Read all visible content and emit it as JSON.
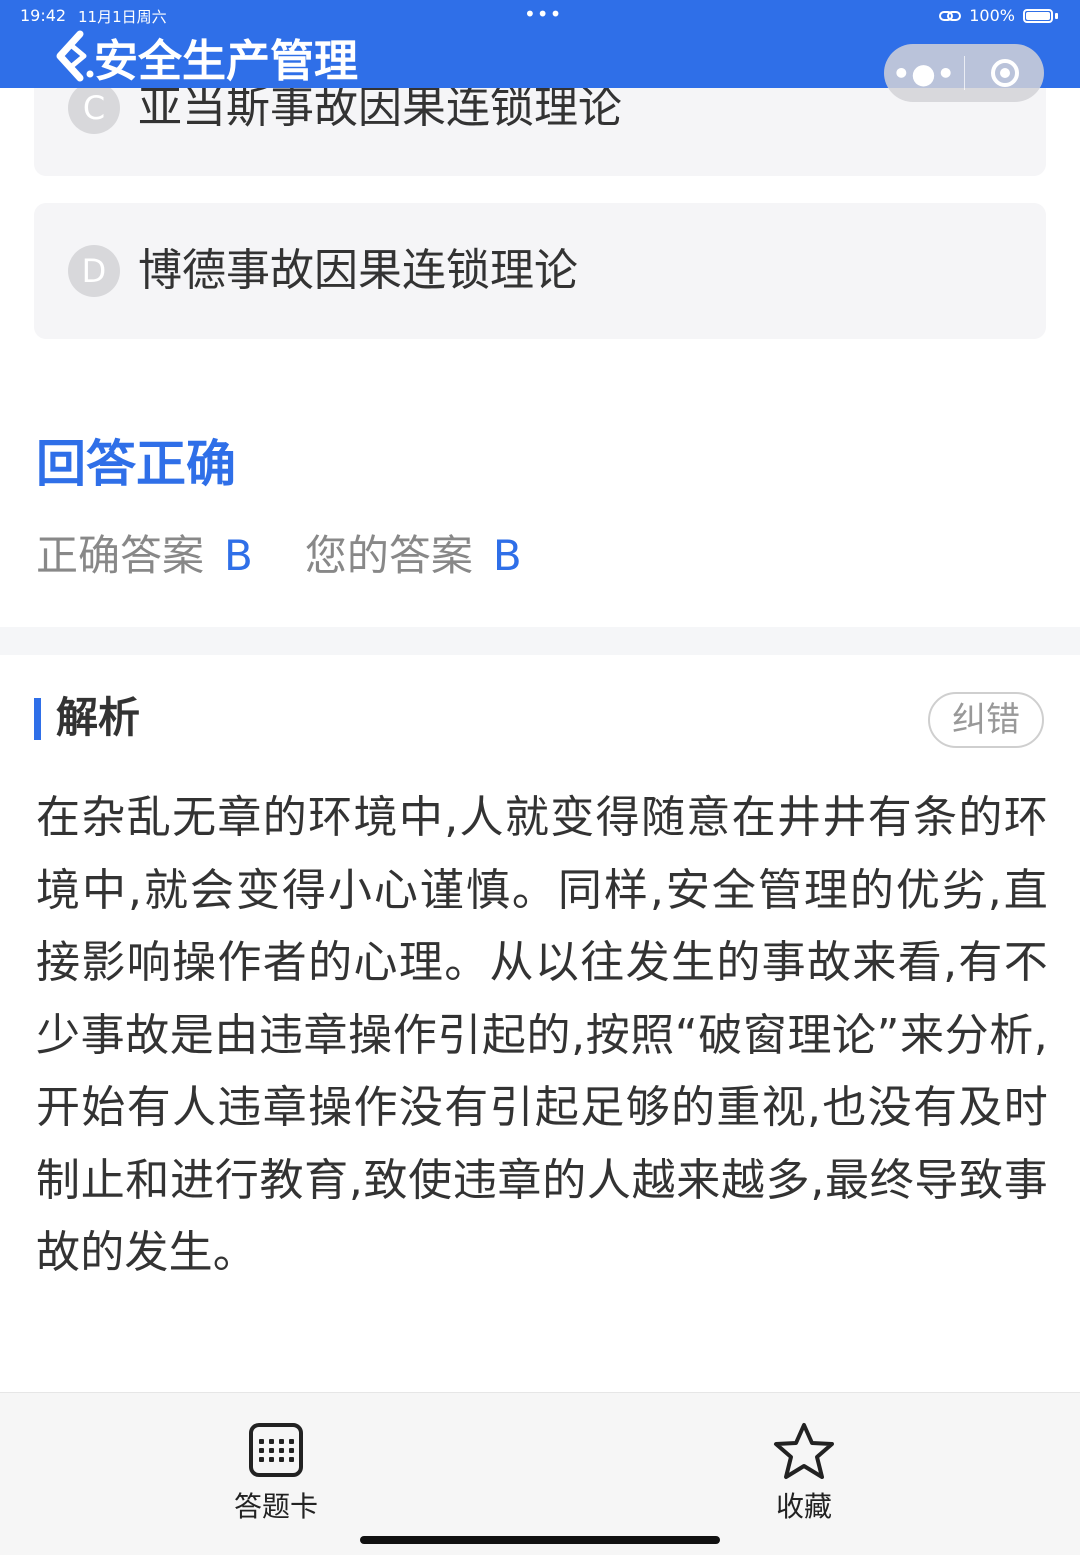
{
  "status_bar": {
    "time": "19:42",
    "date": "11月1日周六",
    "dots": "•••",
    "battery_text": "100%",
    "battery_level": 1.0
  },
  "header": {
    "title": "安全生产管理",
    "background_color": "#2f6fe8",
    "capsule_more_icon": "more-dots-icon",
    "capsule_close_icon": "target-close-icon"
  },
  "options": [
    {
      "letter": "C",
      "text": "亚当斯事故因果连锁理论"
    },
    {
      "letter": "D",
      "text": "博德事故因果连锁理论"
    }
  ],
  "result": {
    "status": "回答正确",
    "correct_label": "正确答案",
    "correct_value": "B",
    "your_label": "您的答案",
    "your_value": "B"
  },
  "analysis": {
    "title": "解析",
    "report_button": "纠错",
    "text": "在杂乱无章的环境中,人就变得随意在井井有条的环境中,就会变得小心谨慎。同样,安全管理的优劣,直接影响操作者的心理。从以往发生的事故来看,有不少事故是由违章操作引起的,按照“破窗理论”来分析,开始有人违章操作没有引起足够的重视,也没有及时制止和进行教育,致使违章的人越来越多,最终导致事故的发生。"
  },
  "bottom_bar": {
    "answer_card_label": "答题卡",
    "answer_card_icon": "grid-icon",
    "favorite_label": "收藏",
    "favorite_icon": "star-icon"
  },
  "colors": {
    "accent": "#2f6fe8",
    "option_bg": "#f5f5f7",
    "muted_text": "#888888"
  }
}
